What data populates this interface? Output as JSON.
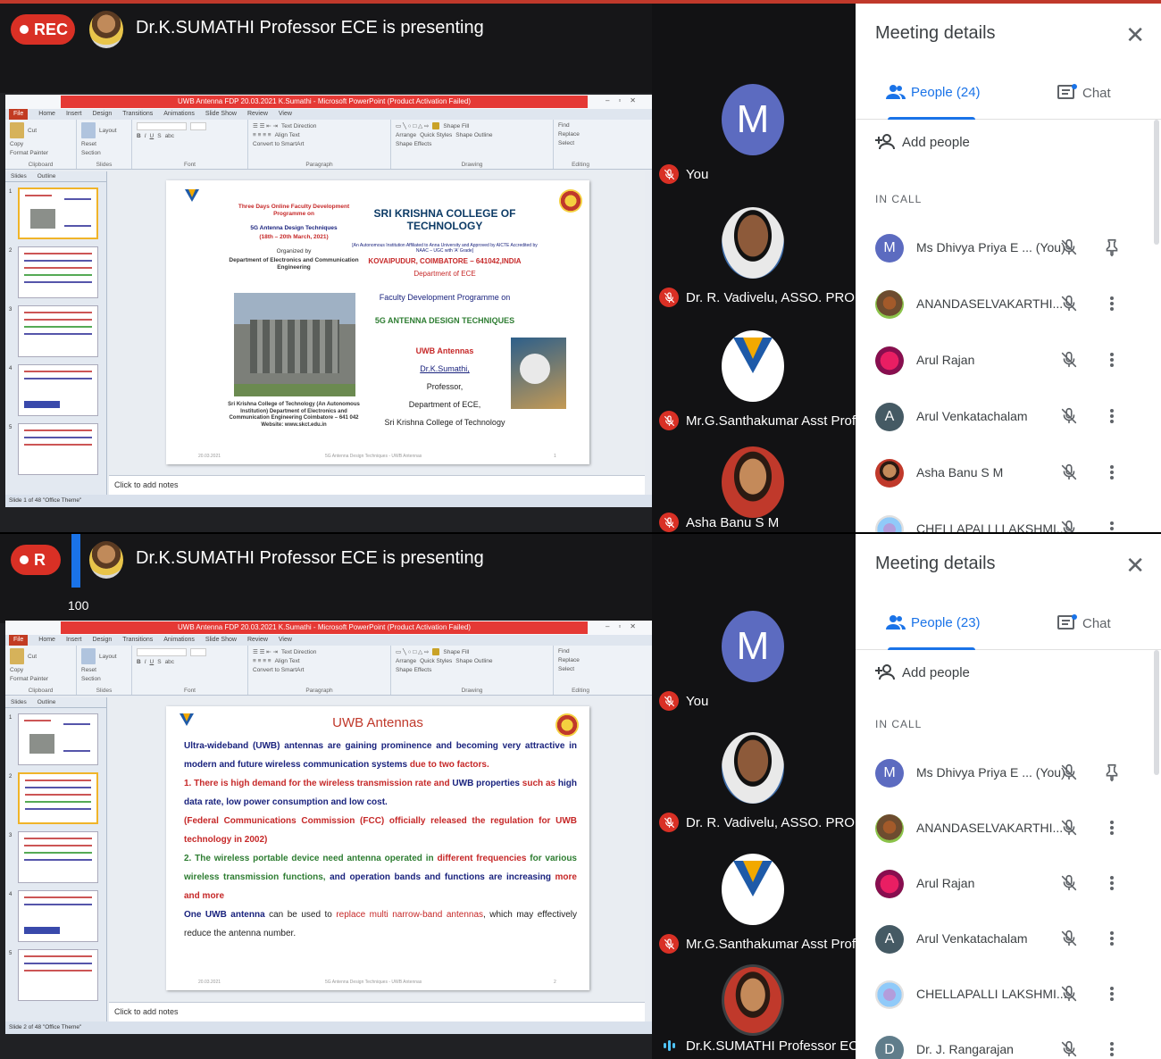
{
  "frames": [
    {
      "rec_label": "REC",
      "presenting_text": "Dr.K.SUMATHI Professor ECE is presenting",
      "ppt": {
        "title": "UWB Antenna FDP 20.03.2021 K.Sumathi - Microsoft PowerPoint (Product Activation Failed)",
        "tabs": [
          "File",
          "Home",
          "Insert",
          "Design",
          "Transitions",
          "Animations",
          "Slide Show",
          "Review",
          "View"
        ],
        "ribbon_groups": [
          "Clipboard",
          "Slides",
          "Font",
          "Paragraph",
          "Drawing",
          "Editing"
        ],
        "ribbon_items": {
          "paste": "Paste",
          "cut": "Cut",
          "copy": "Copy",
          "format_painter": "Format Painter",
          "new_slide": "New Slide",
          "layout": "Layout",
          "reset": "Reset",
          "section": "Section",
          "text_direction": "Text Direction",
          "align_text": "Align Text",
          "convert_smartart": "Convert to SmartArt",
          "arrange": "Arrange",
          "quick_styles": "Quick Styles",
          "shape_fill": "Shape Fill",
          "shape_outline": "Shape Outline",
          "shape_effects": "Shape Effects",
          "find": "Find",
          "replace": "Replace",
          "select": "Select"
        },
        "panel_tabs": [
          "Slides",
          "Outline"
        ],
        "notes_placeholder": "Click to add notes",
        "status_text": "Slide 1 of 48   \"Office Theme\"",
        "slide": {
          "left_title": "Three Days Online Faculty Development Programme on",
          "left_subtitle": "5G Antenna Design Techniques",
          "left_dates": "(18th – 20th March, 2021)",
          "organized_by": "Organized by",
          "organizer_dept": "Department of Electronics and Communication Engineering",
          "college_caption": "Sri Krishna College of Technology (An Autonomous Institution) Department of Electronics and Communication Engineering Coimbatore – 641 042 Website: www.skct.edu.in",
          "college_name": "SRI KRISHNA COLLEGE OF TECHNOLOGY",
          "affiliation": "[An Autonomous Institution Affiliated to Anna University and Approved by AICTE Accredited by NAAC – UGC with 'A' Grade]",
          "address": "KOVAIPUDUR, COIMBATORE – 641042,INDIA",
          "department": "Department of ECE",
          "fdp_line": "Faculty Development Programme on",
          "fdp_topic": "5G ANTENNA DESIGN TECHNIQUES",
          "talk_title": "UWB Antennas",
          "speaker": "Dr.K.Sumathi,",
          "designation": "Professor,",
          "speaker_dept": "Department of ECE,",
          "speaker_college": "Sri Krishna College of Technology",
          "footer_date": "20.03.2021",
          "footer_mid": "5G Antenna Design Techniques - UWB Antennas",
          "footer_page": "1"
        }
      },
      "tiles": [
        {
          "name": "You",
          "initial": "M"
        },
        {
          "name": "Dr. R. Vadivelu, ASSO. PROF"
        },
        {
          "name": "Mr.G.Santhakumar Asst Prof..."
        },
        {
          "name": "Asha Banu S M"
        }
      ],
      "side": {
        "title": "Meeting details",
        "people_tab": "People (24)",
        "chat_tab": "Chat",
        "add_people": "Add people",
        "in_call": "IN CALL",
        "people": [
          {
            "name": "Ms Dhivya Priya E ... (You)",
            "initial": "M"
          },
          {
            "name": "ANANDASELVAKARTHI..."
          },
          {
            "name": "Arul Rajan"
          },
          {
            "name": "Arul Venkatachalam",
            "initial": "A"
          },
          {
            "name": "Asha Banu S M"
          },
          {
            "name": "CHELLAPALLI LAKSHMI..."
          }
        ]
      }
    },
    {
      "rec_label": "R",
      "presenting_text": "Dr.K.SUMATHI Professor ECE is presenting",
      "tooltip": "100",
      "ppt": {
        "title": "UWB Antenna FDP 20.03.2021 K.Sumathi - Microsoft PowerPoint (Product Activation Failed)",
        "notes_placeholder": "Click to add notes",
        "status_text": "Slide 2 of 48   \"Office Theme\"",
        "slide": {
          "title": "UWB Antennas",
          "p1a": "Ultra-wideband (UWB) antennas are gaining prominence and becoming very attractive in modern and future wireless communication systems",
          "p1b": " due to two factors.",
          "p2a": "1. There is high demand for the wireless transmission rate and ",
          "p2b": "UWB properties",
          "p2c": " such as ",
          "p2d": "high data rate, low power consumption and low cost.",
          "p3": "(Federal Communications Commission (FCC) officially released the regulation for UWB technology in 2002)",
          "p4a": "2. The wireless portable device need antenna operated in ",
          "p4b": "different frequencies",
          "p4c": " for various wireless transmission functions, ",
          "p4d": "and operation bands and functions are increasing",
          "p4e": " more and more",
          "p5a": "One UWB antenna",
          "p5b": " can be used to ",
          "p5c": "replace multi narrow-band antennas",
          "p5d": ", which may effectively reduce the antenna number.",
          "footer_date": "20.03.2021",
          "footer_mid": "5G Antenna Design Techniques - UWB Antennas",
          "footer_page": "2"
        }
      },
      "tiles": [
        {
          "name": "You",
          "initial": "M"
        },
        {
          "name": "Dr. R. Vadivelu, ASSO. PROF"
        },
        {
          "name": "Mr.G.Santhakumar Asst Prof..."
        },
        {
          "name": "Dr.K.SUMATHI Professor ECE"
        }
      ],
      "side": {
        "title": "Meeting details",
        "people_tab": "People (23)",
        "chat_tab": "Chat",
        "add_people": "Add people",
        "in_call": "IN CALL",
        "people": [
          {
            "name": "Ms Dhivya Priya E ... (You)",
            "initial": "M"
          },
          {
            "name": "ANANDASELVAKARTHI..."
          },
          {
            "name": "Arul Rajan"
          },
          {
            "name": "Arul Venkatachalam",
            "initial": "A"
          },
          {
            "name": "CHELLAPALLI LAKSHMI..."
          },
          {
            "name": "Dr. J. Rangarajan",
            "initial": "D"
          }
        ]
      }
    }
  ],
  "colors": {
    "rec_red": "#d93025",
    "accent_blue": "#1a73e8",
    "avatar_purple": "#5c6bc0"
  },
  "icons": [
    "mic-off-icon",
    "close-icon",
    "people-icon",
    "chat-icon",
    "add-person-icon",
    "pin-icon",
    "more-vert-icon"
  ]
}
